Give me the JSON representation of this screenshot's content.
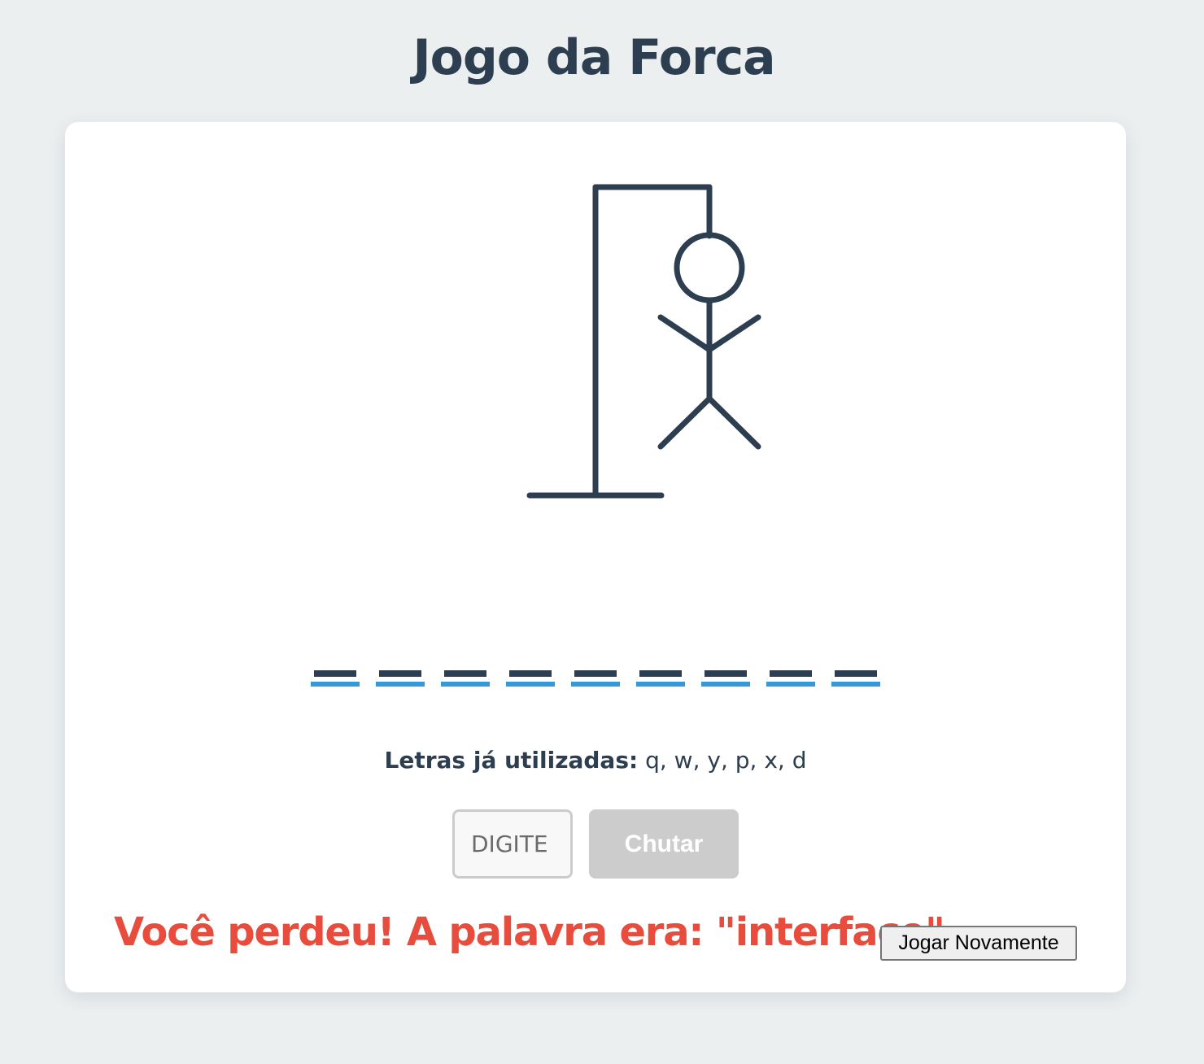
{
  "page": {
    "title": "Jogo da Forca"
  },
  "game": {
    "word_length": 9,
    "mistakes": 6,
    "used_letters_label": "Letras já utilizadas:",
    "used_letters": "q, w, y, p, x, d",
    "input_placeholder": "DIGITE",
    "guess_button_label": "Chutar",
    "result_message": "Você perdeu! A palavra era: \"interface\"",
    "play_again_label": "Jogar Novamente"
  },
  "colors": {
    "background": "#ebeff0",
    "primary": "#2c3e50",
    "accent": "#3498db",
    "lose": "#e74c3c",
    "disabled": "#cccccc"
  }
}
